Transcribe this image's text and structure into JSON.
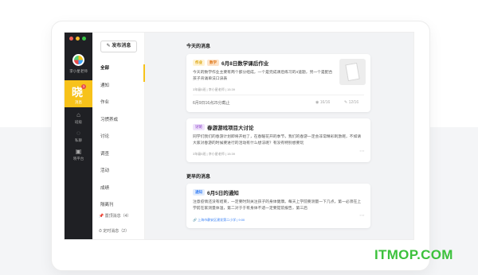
{
  "rail": {
    "window_dot_colors": [
      "#f25f58",
      "#f7bd2f",
      "#37c445"
    ],
    "account_name": "李小星老师",
    "active_glyph": "晓",
    "active_badge": "3",
    "active_label": "消息",
    "items": [
      {
        "icon": "home-icon",
        "glyph": "⌂",
        "label": "班级"
      },
      {
        "icon": "chat-icon",
        "glyph": "◌",
        "label": "私聊"
      },
      {
        "icon": "toolbox-icon",
        "glyph": "▣",
        "label": "晓平台"
      }
    ]
  },
  "nav": {
    "publish_label": "发布消息",
    "items": [
      {
        "label": "全部",
        "active": true
      },
      {
        "label": "通知",
        "active": false
      },
      {
        "label": "作业",
        "active": false
      },
      {
        "label": "习惯养成",
        "active": false
      },
      {
        "label": "讨论",
        "active": false
      },
      {
        "label": "调查",
        "active": false
      },
      {
        "label": "活动",
        "active": false
      },
      {
        "label": "成绩",
        "active": false
      },
      {
        "label": "隔离刊",
        "active": false
      }
    ],
    "pinned_label": "置顶消息（4）",
    "scheduled_label": "定时消息（2）"
  },
  "today": {
    "heading": "今天的消息",
    "homework": {
      "tags": [
        "作业",
        "数学"
      ],
      "title": "6月8日数学课后作业",
      "body": "今天的数学作业主要有两个部分组成，一个是完成课后练习的4道题，另一个是配合孩子背诵单法口诀表",
      "meta": "3年级5班 | 李小星老师 | 15:39",
      "deadline": "6月9日16点25分截止",
      "views": "16/16",
      "done": "12/16"
    },
    "discussion": {
      "tag": "讨论",
      "title": "春游游戏项目大讨论",
      "body": "同学们我们的春游计划即将开始了，在春暖花开的季节，我们的春游一定会非常精彩刺激呢，不如请大家对春游的时候要进行的活动有什么想法呢？有没有特别想要玩",
      "meta": "3年级5班 | 李小星老师 | 15:39"
    }
  },
  "earlier": {
    "heading": "更早的消息",
    "notice": {
      "tag": "通知",
      "title": "6月5日的通知",
      "body": "注意疫情还没有结束，一定要时刻关注孩子的身体健康。每天上学前要测量一下几点，第一必须在上学前在家测量体温，第二对于于有身体不适一定要提前报告，第三后",
      "meta": "3年级5班 | 李小星老师 | 15:39",
      "link": "上海市静安区建发第二小学 | 9:00"
    }
  },
  "colors": {
    "accent": "#f7c21a",
    "rail_bg": "#1f2024",
    "tag_homework": "#fff3d6",
    "tag_subject": "#fde3c9",
    "tag_discussion": "#efe3fb",
    "tag_notice": "#e2ecfc"
  },
  "watermark": "ITMOP.COM"
}
